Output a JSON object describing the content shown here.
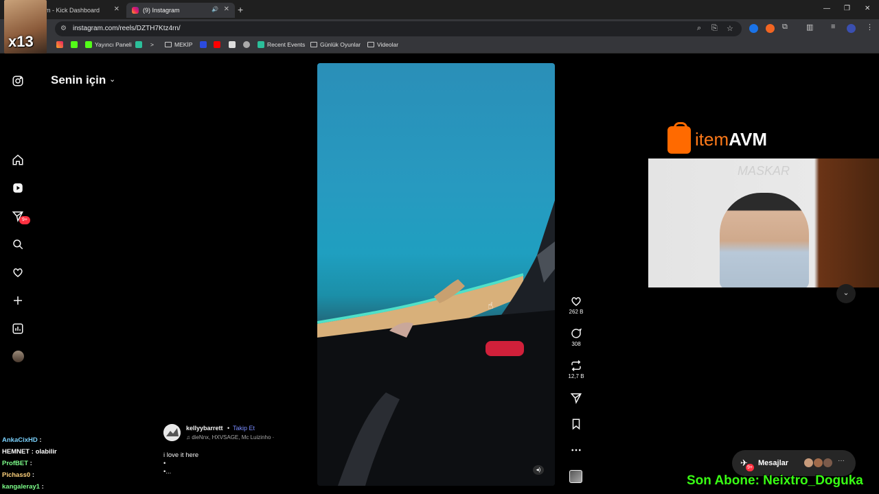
{
  "browser": {
    "tabs": [
      {
        "title": "m - Kick Dashboard",
        "active": false
      },
      {
        "title": "(9) Instagram",
        "active": true
      }
    ],
    "url": "instagram.com/reels/DZTH7Ktz4rn/",
    "bookmarks": [
      "Yayıncı Paneli",
      "MEKİP",
      "Recent Events",
      "Günlük Oyunlar",
      "Videolar"
    ]
  },
  "overlay": {
    "streamer_label": "x13",
    "sponsor_prefix": "item",
    "sponsor_suffix": "AVM",
    "webcam_watermark": "MASKAR",
    "subscriber_banner": "Son Abone: Neixtro_Doguka"
  },
  "instagram": {
    "feed_title": "Senin için",
    "sidebar": [
      {
        "name": "instagram-logo-icon"
      },
      {
        "name": "home-icon"
      },
      {
        "name": "reels-icon"
      },
      {
        "name": "direct-messages-icon",
        "badge": "9+"
      },
      {
        "name": "search-icon"
      },
      {
        "name": "notifications-heart-icon"
      },
      {
        "name": "create-plus-icon"
      },
      {
        "name": "dashboard-icon"
      },
      {
        "name": "profile-avatar"
      }
    ],
    "reel": {
      "actions": {
        "likes": "262 B",
        "comments": "308",
        "reposts": "12,7 B"
      },
      "username": "kellyybarrett",
      "separator": "•",
      "follow_label": "Takip Et",
      "music": "dieNnx, HXVSAGE, Mc Luizinho ·",
      "caption_lines": [
        "i love it here",
        "•",
        "•..."
      ]
    },
    "messages": {
      "label": "Mesajlar",
      "badge": "9+"
    }
  },
  "chat": [
    {
      "user": "AnkaCixHD",
      "text": ""
    },
    {
      "user": "HEMNET",
      "text": "olabilir"
    },
    {
      "user": "ProfBET",
      "text": ""
    },
    {
      "user": "Pichass0",
      "text": ""
    },
    {
      "user": "kangaleray1",
      "text": ""
    }
  ],
  "colors": {
    "background": "#000000",
    "accent_follow": "#7a8cff",
    "badge_red": "#ff3040",
    "sponsor_orange": "#ff7a1a",
    "banner_green": "#39ff14"
  }
}
